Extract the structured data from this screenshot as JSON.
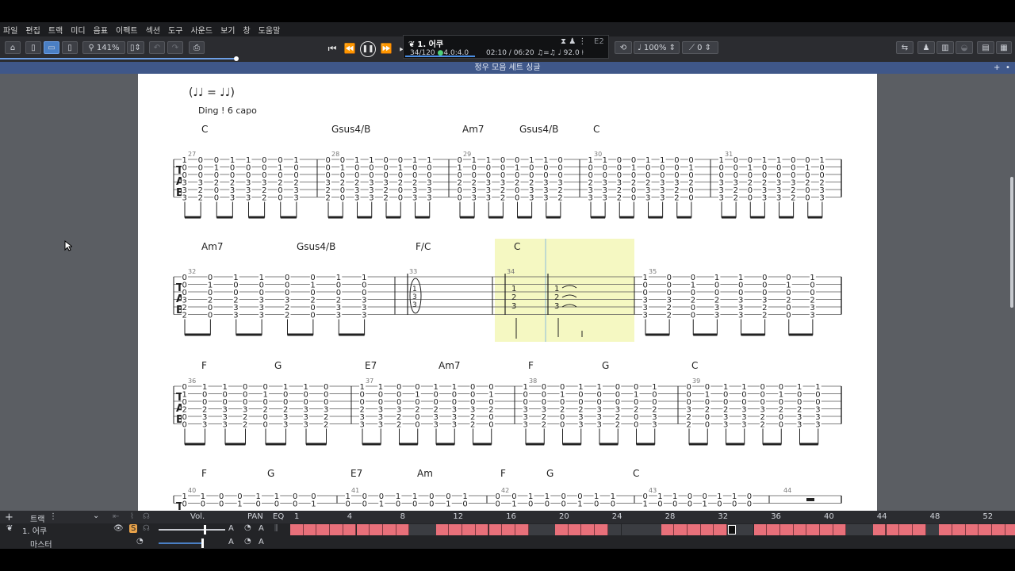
{
  "menu": [
    "파일",
    "편집",
    "트랙",
    "미디",
    "음표",
    "이펙트",
    "섹션",
    "도구",
    "사운드",
    "보기",
    "창",
    "도움말"
  ],
  "toolbar": {
    "zoom": "141%"
  },
  "lcd": {
    "track_name": "1. 어쿠",
    "bar_pos": "34/120",
    "beat_pos": "4.0:4.0",
    "time": "02:10 / 06:20",
    "tempo": "♩ 92.0",
    "key": "E2"
  },
  "doc_title": "정우 모음 세트 싱글",
  "score": {
    "header_text": "Ding ! 6 capo",
    "rows": [
      {
        "measures": [
          "27",
          "28",
          "29",
          "30",
          "31"
        ],
        "chords": [
          "C",
          "Gsus4/B",
          "Am7",
          "Gsus4/B",
          "C"
        ]
      },
      {
        "measures": [
          "32",
          "33",
          "34",
          "35"
        ],
        "chords": [
          "Am7",
          "Gsus4/B",
          "F/C",
          "C"
        ]
      },
      {
        "measures": [
          "36",
          "37",
          "38",
          "39"
        ],
        "chords": [
          "F",
          "G",
          "E7",
          "Am7",
          "F",
          "G",
          "C"
        ]
      },
      {
        "measures": [
          "40",
          "41",
          "42",
          "43",
          "44"
        ],
        "chords": [
          "F",
          "G",
          "E7",
          "Am",
          "F",
          "G",
          "C"
        ]
      }
    ]
  },
  "tracks": {
    "header_label": "트랙",
    "vol_label": "Vol.",
    "pan_label": "PAN",
    "eq_label": "EQ",
    "track1_name": "1. 어쿠",
    "master_name": "마스터",
    "timeline_numbers": [
      "1",
      "4",
      "8",
      "12",
      "16",
      "20",
      "24",
      "28",
      "32",
      "36",
      "40",
      "44",
      "48",
      "52"
    ]
  },
  "colors": {
    "accent": "#4a7fc4",
    "highlight": "#f5f8c2",
    "track_bar": "#e8707a"
  }
}
